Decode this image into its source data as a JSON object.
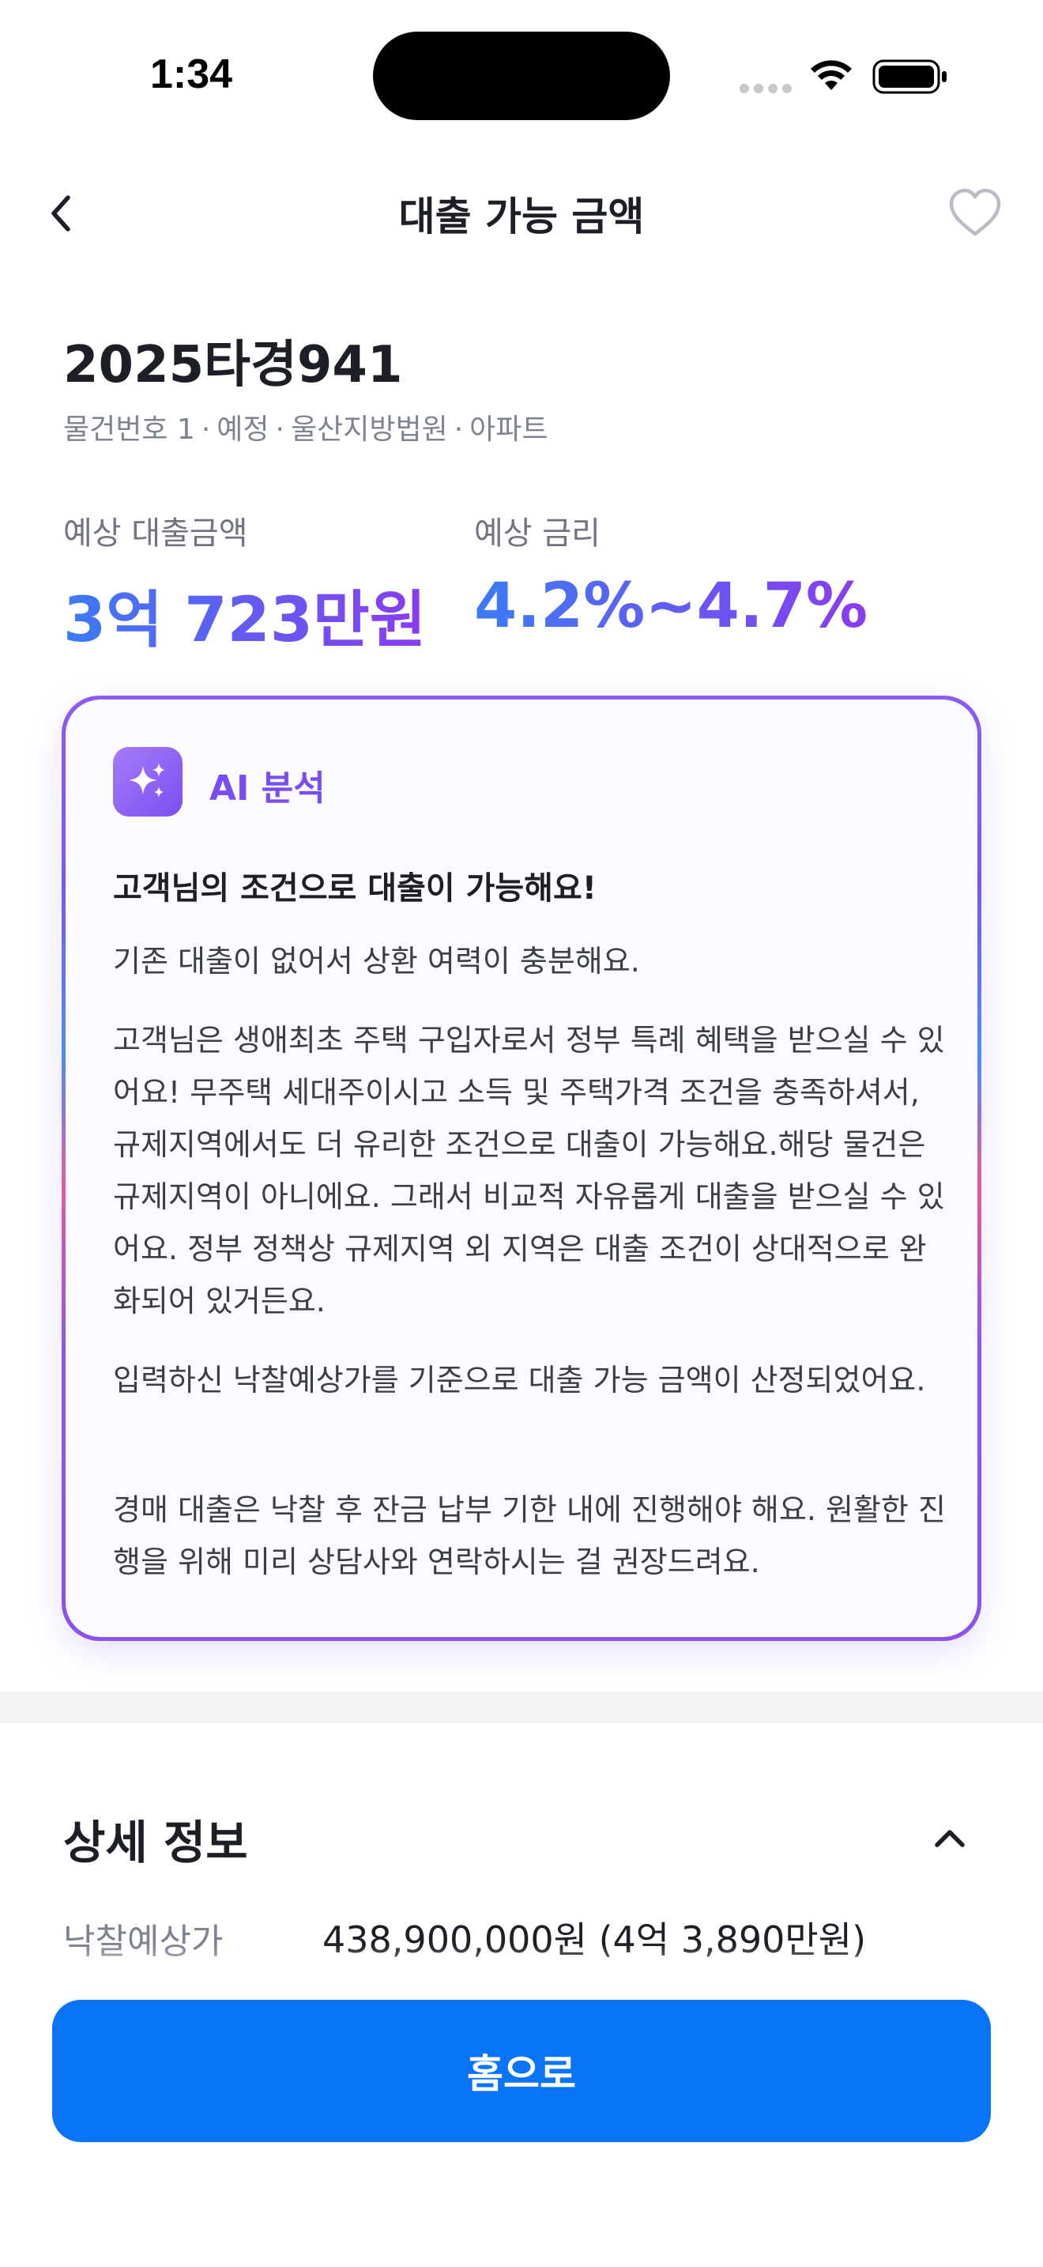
{
  "status_bar": {
    "time": "1:34"
  },
  "nav": {
    "title": "대출 가능 금액",
    "back_icon": "chevron-left-icon",
    "favorite_icon": "heart-outline-icon"
  },
  "header": {
    "case_number": "2025타경941",
    "meta": [
      "물건번호 1",
      "예정",
      "울산지방법원",
      "아파트"
    ],
    "meta_separator": "·"
  },
  "stats": {
    "loan": {
      "label": "예상 대출금액",
      "value": "3억 723만원"
    },
    "rate": {
      "label": "예상 금리",
      "value": "4.2%~4.7%"
    }
  },
  "ai_card": {
    "icon": "sparkles-icon",
    "label": "AI 분석",
    "headline": "고객님의 조건으로 대출이 가능해요!",
    "paragraphs": [
      "기존 대출이 없어서 상환 여력이 충분해요.",
      "고객님은 생애최초 주택 구입자로서 정부 특례 혜택을 받으실 수 있어요! 무주택 세대주이시고 소득 및 주택가격 조건을 충족하셔서, 규제지역에서도 더 유리한 조건으로 대출이 가능해요.해당 물건은 규제지역이 아니에요. 그래서 비교적 자유롭게 대출을 받으실 수 있어요. 정부 정책상 규제지역 외 지역은 대출 조건이 상대적으로 완화되어 있거든요.",
      "입력하신 낙찰예상가를 기준으로 대출 가능 금액이 산정되었어요.",
      "경매 대출은 낙찰 후 잔금 납부 기한 내에 진행해야 해요. 원활한 진행을 위해 미리 상담사와 연락하시는 걸 권장드려요."
    ]
  },
  "details": {
    "title": "상세 정보",
    "collapse_icon": "chevron-up-icon",
    "rows": [
      {
        "label": "낙찰예상가",
        "value": "438,900,000원 (4억 3,890만원)"
      }
    ]
  },
  "cta": {
    "label": "홈으로",
    "color": "#0a74f7"
  },
  "colors": {
    "accent_gradient_start": "#3b7bf5",
    "accent_gradient_end": "#8a3cf0",
    "ai_purple": "#7a4df0"
  }
}
